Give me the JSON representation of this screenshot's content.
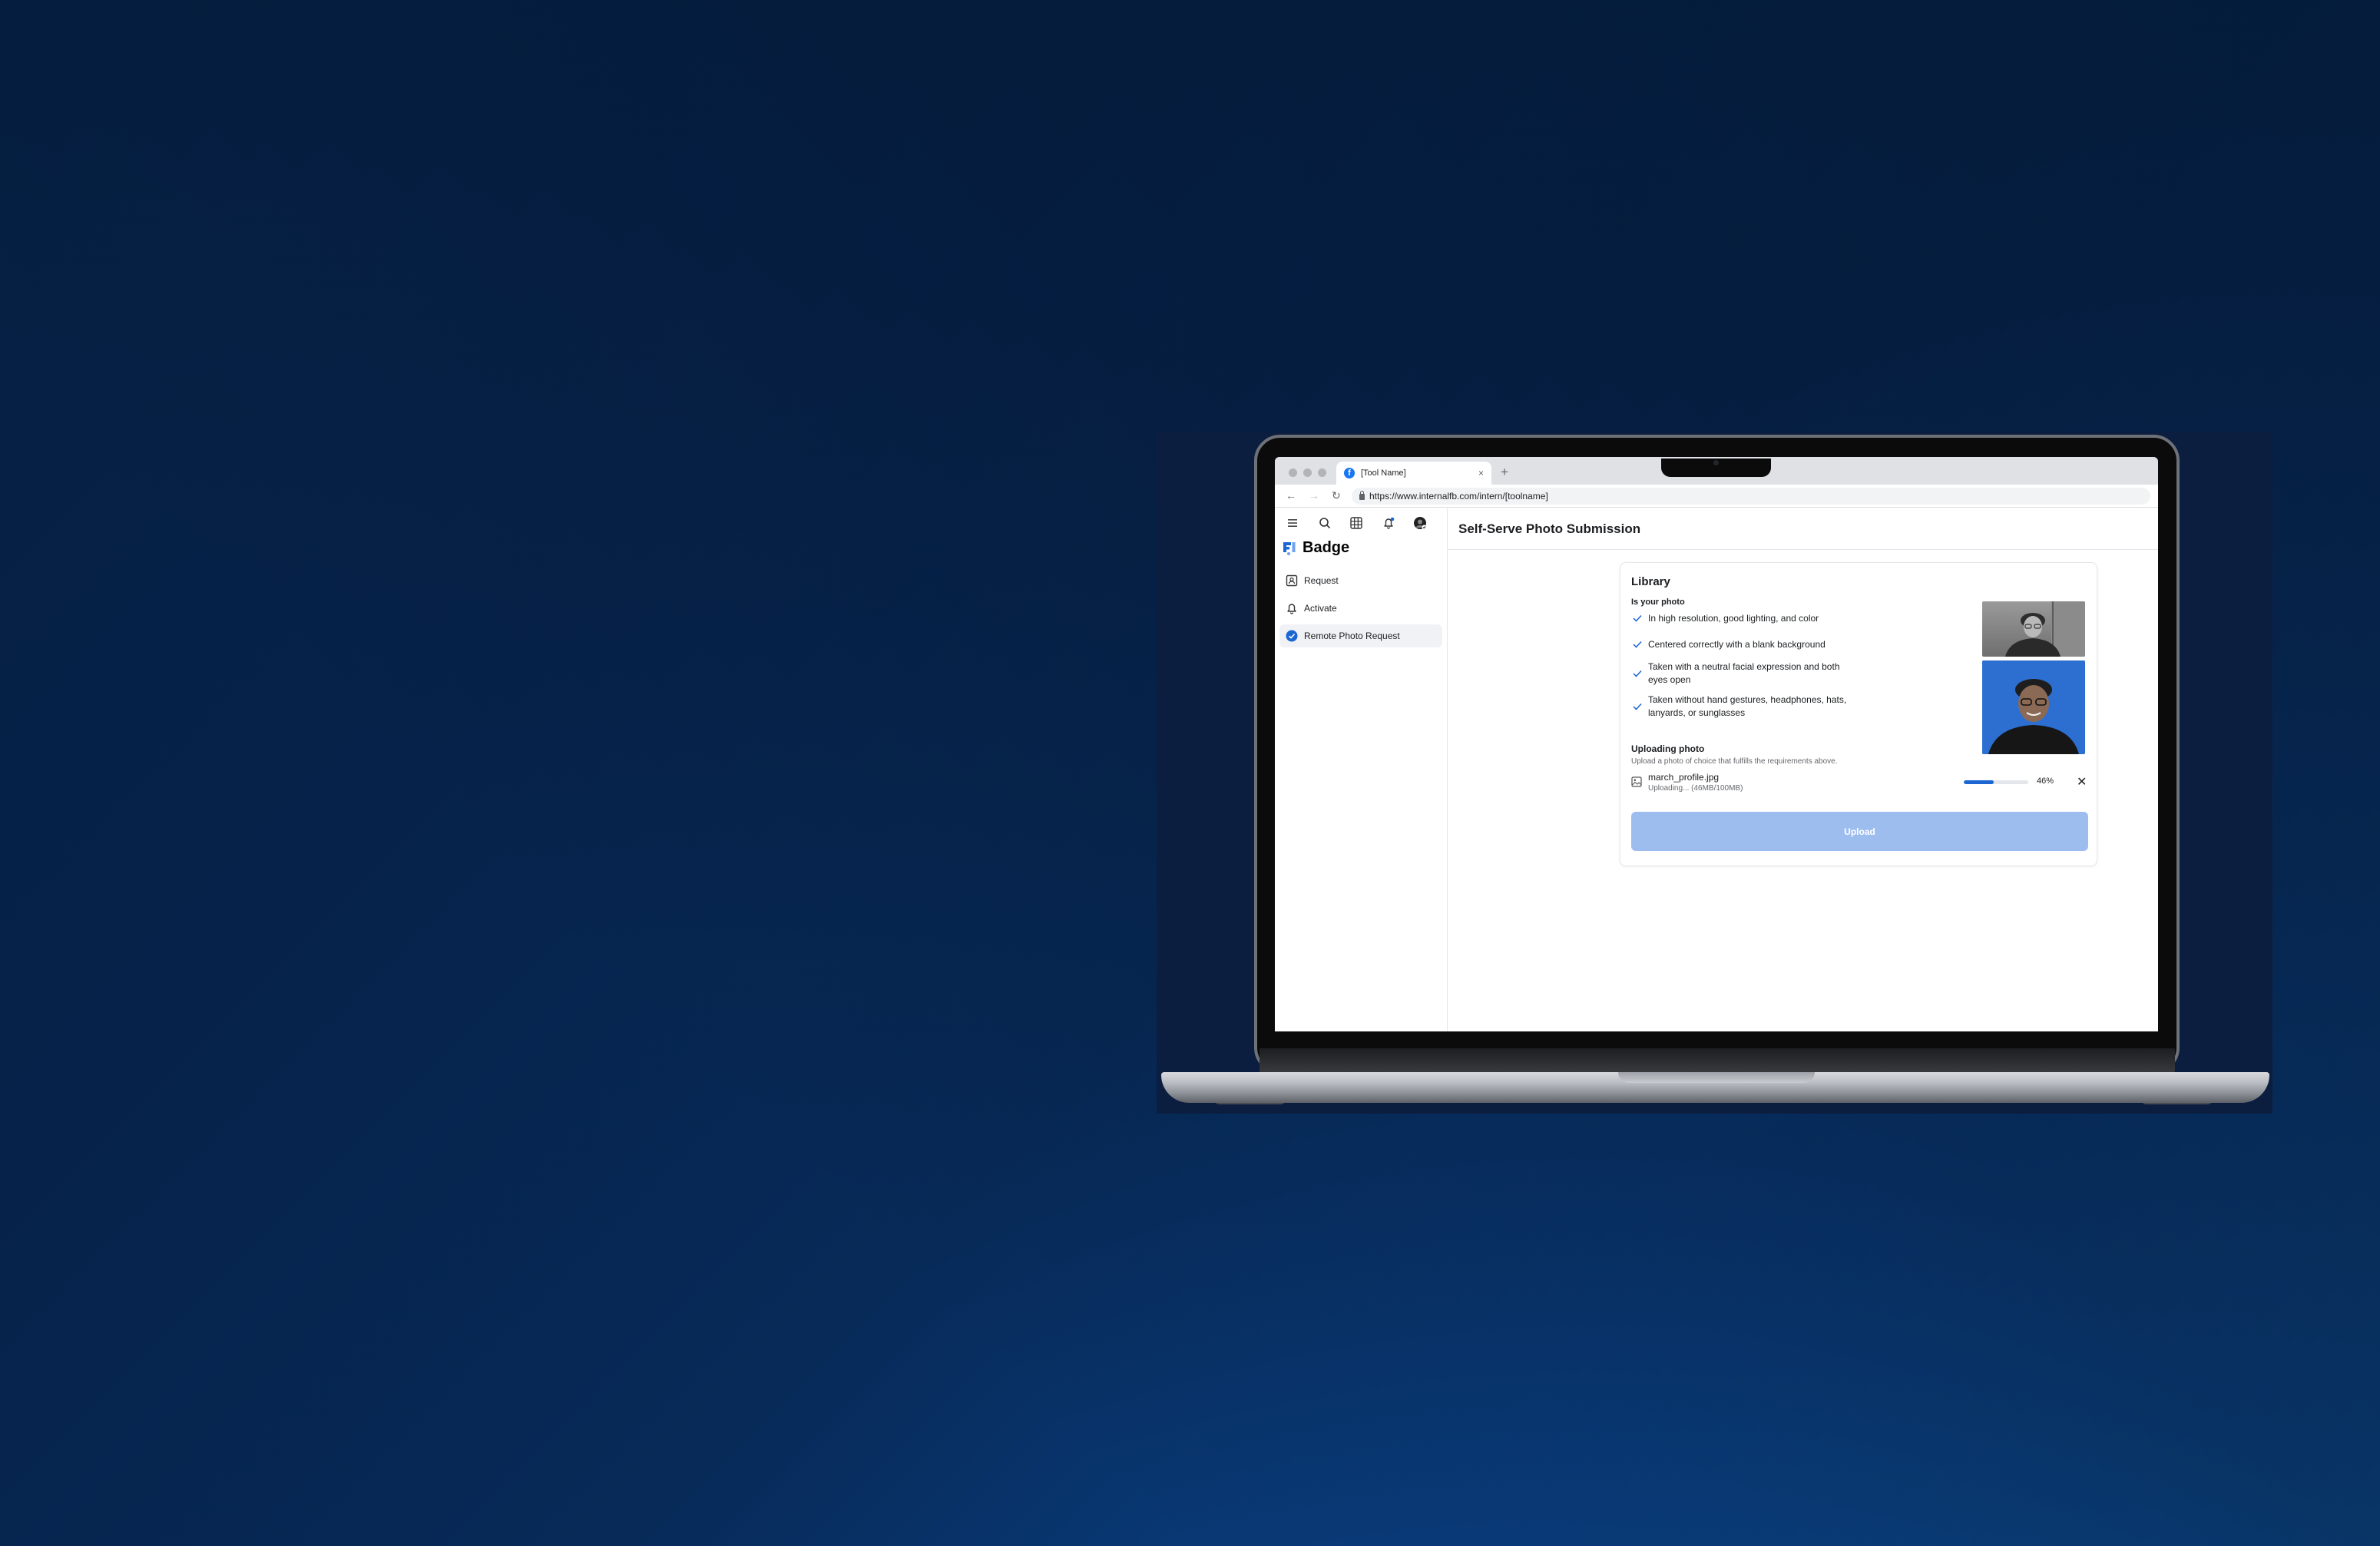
{
  "browser": {
    "tab_title": "[Tool Name]",
    "tab_close": "×",
    "new_tab": "+",
    "url": "https://www.internalfb.com/intern/[toolname]",
    "nav": {
      "back": "←",
      "forward": "→",
      "reload": "↻"
    }
  },
  "sidebar": {
    "app_name": "Badge",
    "items": [
      {
        "label": "Request",
        "icon": "request-icon",
        "active": false
      },
      {
        "label": "Activate",
        "icon": "activate-icon",
        "active": false
      },
      {
        "label": "Remote Photo Request",
        "icon": "check-circle-icon",
        "active": true
      }
    ]
  },
  "page": {
    "title": "Self-Serve Photo Submission"
  },
  "library": {
    "title": "Library",
    "requirements_heading": "Is your photo",
    "requirements": [
      "In high resolution, good lighting, and color",
      "Centered correctly with a blank background",
      "Taken with a neutral facial expression and both eyes open",
      "Taken without hand gestures, headphones, hats, lanyards, or sunglasses"
    ],
    "upload_heading": "Uploading photo",
    "upload_hint": "Upload a photo of choice that fulfills the requirements above.",
    "file": {
      "name": "march_profile.jpg",
      "status": "Uploading... (46MB/100MB)",
      "progress": 0.46,
      "progress_label": "46%",
      "cancel": "✕"
    },
    "upload_button": "Upload"
  },
  "colors": {
    "accent": "#1b66d3",
    "upload_button_disabled": "#9ebdef",
    "photo_background": "#2c6fd1",
    "background_dark": "#051f41",
    "background_light": "#0e58a6"
  }
}
